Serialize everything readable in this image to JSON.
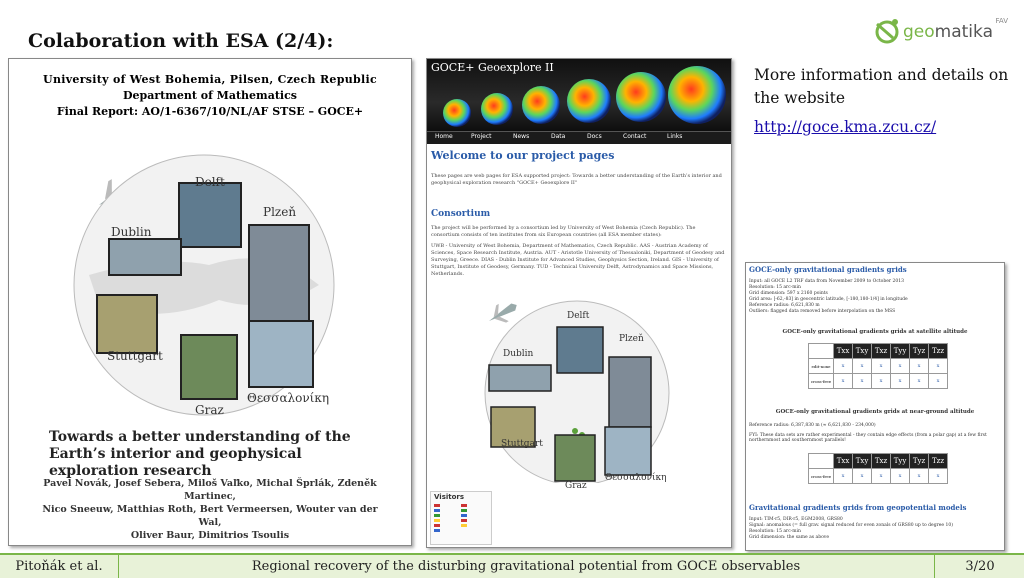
{
  "slide": {
    "title": "Colaboration with ESA (2/4):"
  },
  "logo": {
    "word_a": "geo",
    "word_b": "matika",
    "tag": "FAV"
  },
  "report": {
    "university": "University of West Bohemia, Pilsen, Czech Republic",
    "department": "Department of Mathematics",
    "final_report": "Final Report: AO/1-6367/10/NL/AF STSE – GOCE+",
    "cities": [
      "Delft",
      "Plzeň",
      "Dublin",
      "Stuttgart",
      "Graz",
      "Θεσσαλονίκη"
    ],
    "title": "Towards a better understanding of the Earth’s interior and geophysical exploration research",
    "authors_1": "Pavel Novák, Josef Sebera, Miloš Vaľko, Michal Šprlák, Zdeněk Martinec,",
    "authors_2": "Nico Sneeuw, Matthias Roth, Bert Vermeersen, Wouter van der Wal,",
    "authors_3": "Oliver Baur, Dimitrios Tsoulis"
  },
  "site": {
    "name": "GOCE+ Geoexplore II",
    "nav": [
      "Home",
      "Project",
      "News",
      "Data",
      "Docs",
      "Contact",
      "Links"
    ],
    "welcome": "Welcome to our project pages",
    "intro": "These pages are web pages for ESA supported project: Towards a better understanding of the Earth’s interior and geophysical exploration research \"GOCE+ Geoexplore II\"",
    "consortium_heading": "Consortium",
    "consortium_text": "The project will be performed by a consortium led by University of West Bohemia (Czech Republic). The consortium consists of ten institutes from six European countries (all ESA member states):",
    "partners_text": "UWB - University of West Bohemia, Department of Mathematics, Czech Republic. AAS - Austrian Academy of Sciences, Space Research Institute, Austria. AUT - Aristotle University of Thessaloniki, Department of Geodesy and Surveying, Greece. DIAS - Dublin Institute for Advanced Studies, Geophysics Section, Ireland. GIS - University of Stuttgart, Institute of Geodesy, Germany. TUD - Technical University Delft, Astrodynamics and Space Missions, Netherlands.",
    "cities": [
      "Delft",
      "Plzeň",
      "Dublin",
      "Stuttgart",
      "Graz",
      "Θεσσαλονίκη"
    ],
    "visitors_label": "Visitors"
  },
  "info": {
    "text": "More information and details on the website",
    "url": "http://goce.kma.zcu.cz/"
  },
  "grids": {
    "title": "GOCE-only gravitational gradients grids",
    "lines": [
      "Input: all GOCE L2 TRF data from November 2009 to October 2013",
      "Resolution: 15 arc-min",
      "Grid dimension: 597 x 2160 points",
      "Grid area: [-62,-83] in geocentric latitude, [-180,180-1/4] in longitude",
      "Reference radius: 6,621,830 m",
      "Outliers: flagged data removed before interpolation on the MSS"
    ],
    "sub1": "GOCE-only gravitational gradients grids at satellite altitude",
    "headers": [
      "Txx",
      "Txy",
      "Txz",
      "Tyy",
      "Tyz",
      "Tzz"
    ],
    "row_labels_1": [
      "edit-none",
      "cross-free"
    ],
    "sub2": "GOCE-only gravitational gradients grids at near-ground altitude",
    "ref_line": "Reference radius: 6,387,830 m (≈ 6,621,830 - 234,000)",
    "fyi_line": "FYI: These data sets are rather experimental - they contain edge effects (from a polar gap) at a few first northernmost and southernmost parallels!",
    "row_labels_2": [
      "cross-free"
    ],
    "sub3": "Gravitational gradients grids from geopotential models",
    "bottom_lines": [
      "Input: TIM-r5, DIR-r5, EGM2008, GRS80",
      "Signal: anomalous (= full grav. signal reduced for even zonals of GRS80 up to degree 10)",
      "Resolution: 15 arc-min",
      "Grid dimension: the same as above"
    ],
    "cell": "x"
  },
  "footer": {
    "author": "Pitoňák et al.",
    "title": "Regional recovery of the disturbing gravitational potential from GOCE observables",
    "page": "3/20"
  },
  "colors": {
    "accent": "#7ab648",
    "link": "#1a0dab",
    "heading_blue": "#2a5ba8"
  }
}
